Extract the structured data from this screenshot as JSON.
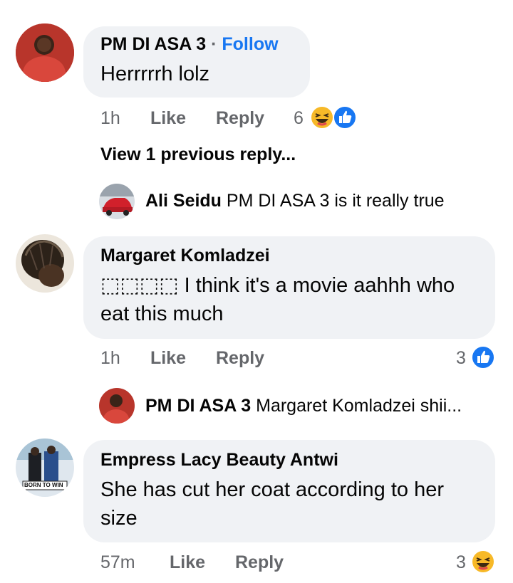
{
  "comments": [
    {
      "author": "PM DI ASA  3",
      "follow_label": "Follow",
      "text": "Herrrrrh lolz",
      "time": "1h",
      "like_label": "Like",
      "reply_label": "Reply",
      "reaction_count": "6",
      "reactions": [
        "haha-emoji",
        "like-thumb"
      ]
    },
    {
      "author": "Margaret Komladzei",
      "text_line1": "⬚⬚⬚⬚ I think it's a movie aahhh who",
      "text_line2": "eat this much",
      "time": "1h",
      "like_label": "Like",
      "reply_label": "Reply",
      "reaction_count": "3",
      "reactions": [
        "like-thumb"
      ]
    },
    {
      "author": "Empress Lacy Beauty Antwi",
      "text_line1": "She has cut her coat according to her",
      "text_line2": "size",
      "time": "57m",
      "like_label": "Like",
      "reply_label": "Reply",
      "reaction_count": "3",
      "reactions": [
        "haha-emoji"
      ],
      "avatar_caption": "BORN TO WIN"
    }
  ],
  "view_previous": "View 1 previous reply...",
  "replies": [
    {
      "author": "Ali Seidu",
      "text": "PM DI ASA  3 is it really true"
    },
    {
      "author": "PM DI ASA  3",
      "text": "Margaret Komladzei shii..."
    }
  ],
  "colors": {
    "bubble": "#f0f2f5",
    "link": "#1877f2",
    "meta": "#65676b",
    "like_blue": "#1877f2",
    "haha_yellow": "#f7b928"
  }
}
